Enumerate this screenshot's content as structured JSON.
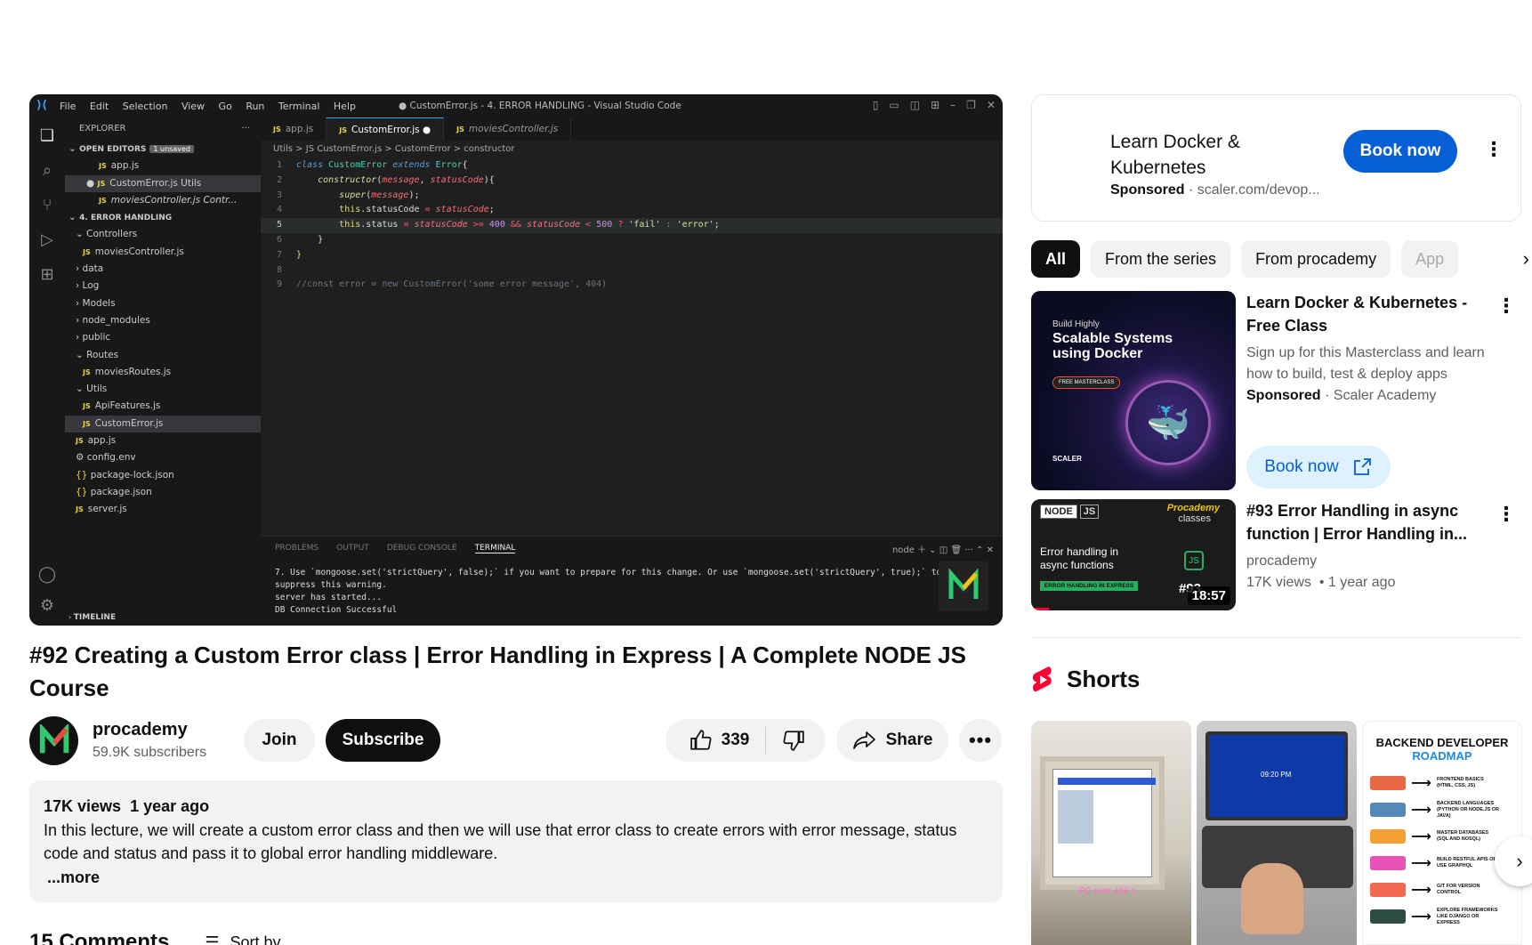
{
  "vscode": {
    "menu": [
      "File",
      "Edit",
      "Selection",
      "View",
      "Go",
      "Run",
      "Terminal",
      "Help"
    ],
    "window_title": "● CustomError.js - 4. ERROR HANDLING - Visual Studio Code",
    "explorer_label": "EXPLORER",
    "open_editors_label": "OPEN EDITORS",
    "unsaved_badge": "1 unsaved",
    "open_editors": [
      "app.js",
      "CustomError.js Utils",
      "moviesController.js Contr..."
    ],
    "project_label": "4. ERROR HANDLING",
    "tree": [
      {
        "label": "Controllers",
        "kind": "folder-open",
        "indent": 1
      },
      {
        "label": "moviesController.js",
        "kind": "js",
        "indent": 2
      },
      {
        "label": "data",
        "kind": "folder",
        "indent": 1
      },
      {
        "label": "Log",
        "kind": "folder",
        "indent": 1
      },
      {
        "label": "Models",
        "kind": "folder",
        "indent": 1
      },
      {
        "label": "node_modules",
        "kind": "folder",
        "indent": 1
      },
      {
        "label": "public",
        "kind": "folder",
        "indent": 1
      },
      {
        "label": "Routes",
        "kind": "folder-open",
        "indent": 1
      },
      {
        "label": "moviesRoutes.js",
        "kind": "js",
        "indent": 2
      },
      {
        "label": "Utils",
        "kind": "folder-open",
        "indent": 1
      },
      {
        "label": "ApiFeatures.js",
        "kind": "js",
        "indent": 2
      },
      {
        "label": "CustomError.js",
        "kind": "js",
        "indent": 2,
        "selected": true
      },
      {
        "label": "app.js",
        "kind": "js",
        "indent": 1
      },
      {
        "label": "config.env",
        "kind": "gear",
        "indent": 1
      },
      {
        "label": "package-lock.json",
        "kind": "json",
        "indent": 1
      },
      {
        "label": "package.json",
        "kind": "json",
        "indent": 1
      },
      {
        "label": "server.js",
        "kind": "js",
        "indent": 1
      }
    ],
    "timeline_label": "TIMELINE",
    "tabs": [
      "app.js",
      "CustomError.js",
      "moviesController.js"
    ],
    "breadcrumb": "Utils > JS CustomError.js > CustomError > constructor",
    "line_numbers": [
      "1",
      "2",
      "3",
      "4",
      "5",
      "6",
      "7",
      "8",
      "9"
    ],
    "comment_line": "//const error = new CustomError('some error message', 404)",
    "terminal_tabs": [
      "PROBLEMS",
      "OUTPUT",
      "DEBUG CONSOLE",
      "TERMINAL"
    ],
    "terminal_shell": "node",
    "terminal_lines": [
      "7. Use `mongoose.set('strictQuery', false);` if you want to prepare for this change. Or use `mongoose.set('strictQuery', true);` to",
      "suppress this warning.",
      "server has started...",
      "DB Connection Successful"
    ]
  },
  "video": {
    "title": "#92 Creating a Custom Error class | Error Handling in Express | A Complete NODE JS Course",
    "channel": "procademy",
    "subscribers": "59.9K subscribers",
    "join_label": "Join",
    "subscribe_label": "Subscribe",
    "likes": "339",
    "share_label": "Share",
    "views": "17K views",
    "age": "1 year ago",
    "description": "In this lecture, we will create a custom error class and then we will use that error class to create errors with error message, status code and status and pass it to global error handling middleware.",
    "more_label": "...more",
    "comments_label": "15 Comments",
    "sort_label": "Sort by"
  },
  "ad": {
    "title": "Learn Docker & Kubernetes",
    "sponsored": "Sponsored",
    "domain": "scaler.com/devop...",
    "cta": "Book now"
  },
  "chips": [
    "All",
    "From the series",
    "From procademy",
    "App"
  ],
  "recommendations": [
    {
      "title": "Learn Docker & Kubernetes - Free Class",
      "desc": "Sign up for this Masterclass and learn how to build, test & deploy apps",
      "sponsored": "Sponsored",
      "advertiser": "Scaler Academy",
      "cta": "Book now",
      "thumb_small": "Build Highly",
      "thumb_big": "Scalable Systems using Docker",
      "thumb_badge": "FREE MASTERCLASS",
      "thumb_brand": "SCALER"
    },
    {
      "title": "#93 Error Handling in async function | Error Handling in...",
      "channel": "procademy",
      "views": "17K views",
      "age": "1 year ago",
      "duration": "18:57",
      "thumb_node": "NODE",
      "thumb_js": "JS",
      "thumb_brand": "Procademy",
      "thumb_brand2": "classes",
      "thumb_text": "Error handling in async functions",
      "thumb_strip": "ERROR HANDLING IN EXPRESS",
      "thumb_num": "#93"
    }
  ],
  "shorts": {
    "label": "Shorts",
    "third_title": "BACKEND DEVELOPER",
    "third_subtitle": "ROADMAP",
    "roadmap": [
      "FRONTEND BASICS (HTML, CSS, JS)",
      "BACKEND LANGUAGES (PYTHON OR NODE.JS OR JAVA)",
      "MASTER DATABASES (SQL AND NOSQL)",
      "BUILD RESTFUL APIS OR USE GRAPHQL",
      "GIT FOR VERSION CONTROL",
      "EXPLORE FRAMEWORKS LIKE DJANGO OR EXPRESS"
    ],
    "first_caption": "PC user 486 >",
    "second_time": "09:20 PM"
  },
  "colors": {
    "accent": "#065fd4",
    "subscribe_bg": "#0f0f0f",
    "chip_bg": "#f2f2f2",
    "shorts_red": "#ff0033"
  }
}
